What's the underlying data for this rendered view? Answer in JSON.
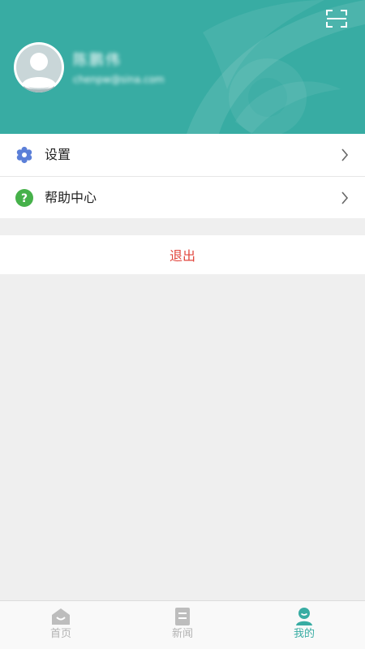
{
  "profile": {
    "name": "陈鹏伟",
    "email": "chenpw@sina.com",
    "avatar_icon": "default-avatar-icon"
  },
  "header": {
    "scan_icon": "scan-icon",
    "bg_color": "#38aca3"
  },
  "menu": {
    "items": [
      {
        "label": "设置",
        "icon": "gear-icon",
        "icon_color": "#5b7fd8"
      },
      {
        "label": "帮助中心",
        "icon": "help-icon",
        "icon_color": "#46b14a"
      }
    ]
  },
  "logout": {
    "label": "退出",
    "color": "#e2463e"
  },
  "tabbar": {
    "tabs": [
      {
        "label": "首页",
        "icon": "home-icon",
        "active": false
      },
      {
        "label": "新闻",
        "icon": "news-icon",
        "active": false
      },
      {
        "label": "我的",
        "icon": "profile-icon",
        "active": true
      }
    ],
    "active_color": "#38aca3"
  }
}
